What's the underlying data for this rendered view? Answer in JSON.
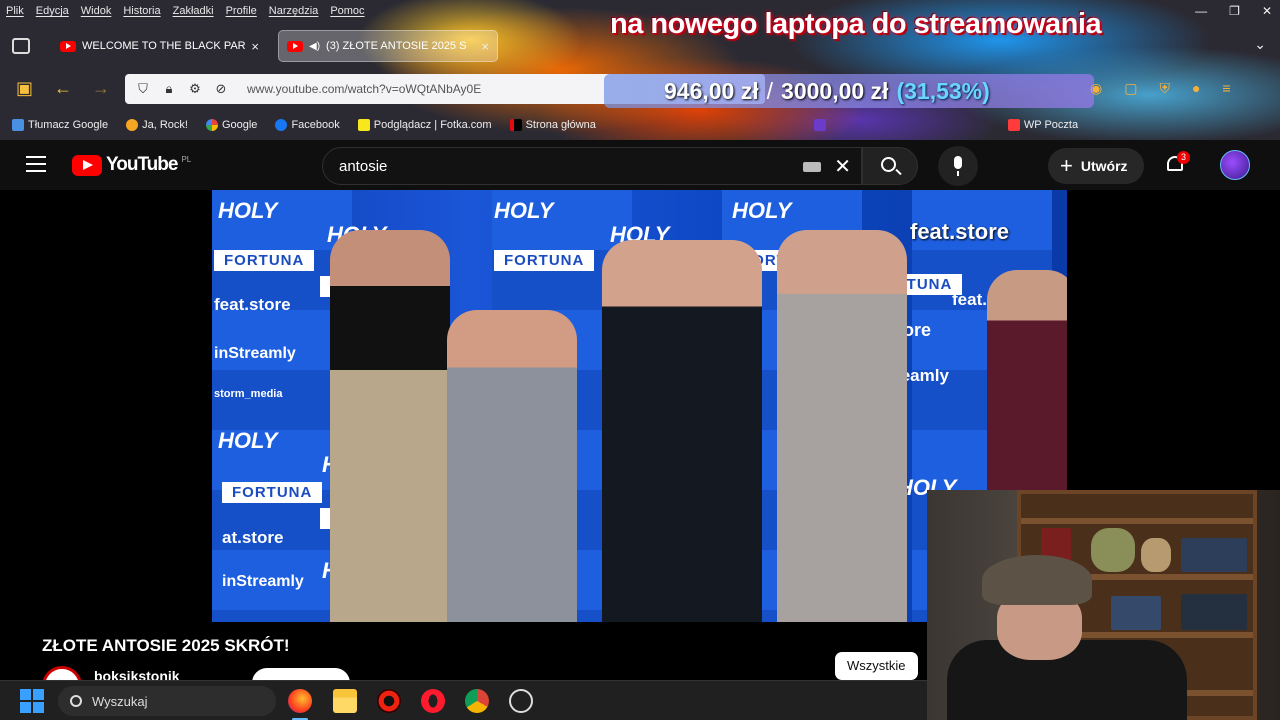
{
  "menubar": [
    "Plik",
    "Edycja",
    "Widok",
    "Historia",
    "Zakładki",
    "Profile",
    "Narzędzia",
    "Pomoc"
  ],
  "overlay": {
    "title": "na nowego laptopa do streamowania",
    "current": "946,00 zł",
    "separator": "/",
    "goal": "3000,00 zł",
    "percent": "(31,53%)"
  },
  "tabs": [
    {
      "title": "WELCOME TO THE BLACK PARA",
      "close": "×",
      "active": false
    },
    {
      "title": "(3) ZŁOTE ANTOSIE 2025 S",
      "close": "×",
      "active": true
    }
  ],
  "url": "www.youtube.com/watch?v=oWQtANbAy0E",
  "bookmarks": [
    {
      "label": "Tłumacz Google",
      "color": "#4a90e2"
    },
    {
      "label": "Ja, Rock!",
      "color": "#f5a623"
    },
    {
      "label": "Google",
      "color": "#ffffff"
    },
    {
      "label": "Facebook",
      "color": "#1877f2"
    },
    {
      "label": "Podglądacz | Fotka.com",
      "color": "#f8e71c"
    },
    {
      "label": "Strona główna",
      "color": "#e50914"
    },
    {
      "label": "",
      "color": "#6a3cc9"
    },
    {
      "label": "WP Poczta",
      "color": "#ff3b3b"
    }
  ],
  "youtube": {
    "logo_text": "YouTube",
    "country": "PL",
    "search_query": "antosie",
    "create_label": "Utwórz",
    "notifications": "3",
    "video_title": "ZŁOTE ANTOSIE 2025 SKRÓT!",
    "channel_name": "boksikstonik",
    "filter_label": "Wszystkie",
    "watermark": "feat.store"
  },
  "stage": {
    "holy": "HOLY",
    "fortuna": "FORTUNA",
    "featstore": "feat.store",
    "instreamly": "inStreamly",
    "storm": "storm_media",
    "atstore": "at.store"
  },
  "taskbar": {
    "search_label": "Wyszukaj"
  },
  "colors": {
    "youtube_red": "#ff0000",
    "accent_blue": "#3aa0ff",
    "donation_pct": "#6ad6ff"
  }
}
